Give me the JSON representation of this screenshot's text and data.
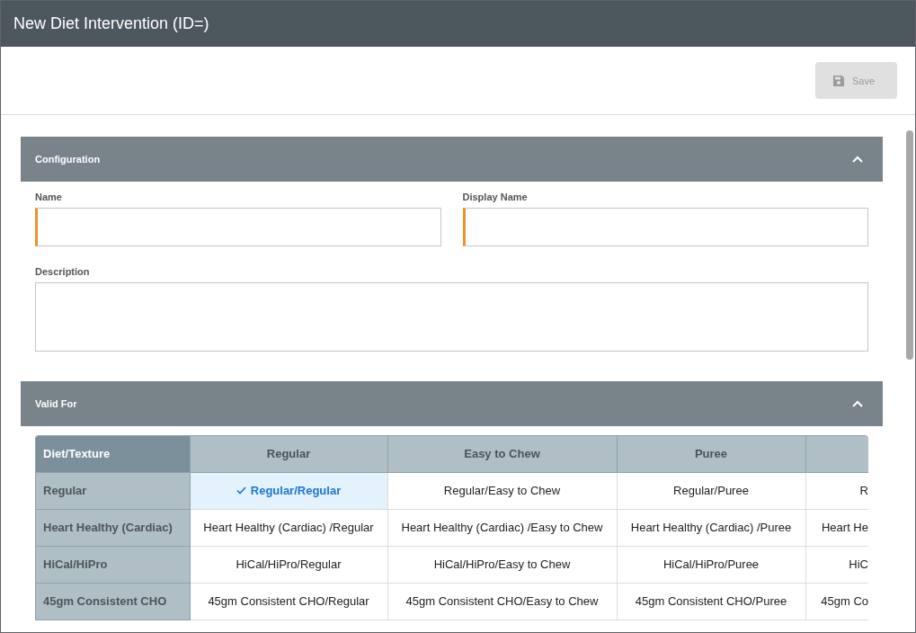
{
  "window": {
    "title": "New Diet Intervention (ID=)"
  },
  "toolbar": {
    "save_button": {
      "label": "Save",
      "disabled": true
    }
  },
  "sections": [
    {
      "title": "Configuration",
      "expanded": true,
      "fields": [
        {
          "label": "Name",
          "kind": "text",
          "required": true
        },
        {
          "label": "Display Name",
          "kind": "text",
          "required": true
        },
        {
          "label": "Description",
          "kind": "textarea",
          "required": false
        }
      ]
    },
    {
      "title": "Valid For",
      "expanded": true,
      "table": {
        "corner": "Diet/Texture",
        "columns": [
          "Regular",
          "Easy to Chew",
          "Puree"
        ],
        "rows": [
          {
            "label": "Regular",
            "cells": [
              {
                "text": "Regular/Regular",
                "selected": true
              },
              {
                "text": "Regular/Easy to Chew",
                "selected": false
              },
              {
                "text": "Regular/Puree",
                "selected": false
              },
              {
                "text": "R",
                "selected": false
              }
            ]
          },
          {
            "label": "Heart Healthy (Cardiac)",
            "cells": [
              {
                "text": "Heart Healthy (Cardiac) /Regular",
                "selected": false
              },
              {
                "text": "Heart Healthy (Cardiac) /Easy to Chew",
                "selected": false
              },
              {
                "text": "Heart Healthy (Cardiac) /Puree",
                "selected": false
              },
              {
                "text": "Heart He",
                "selected": false
              }
            ]
          },
          {
            "label": "HiCal/HiPro",
            "cells": [
              {
                "text": "HiCal/HiPro/Regular",
                "selected": false
              },
              {
                "text": "HiCal/HiPro/Easy to Chew",
                "selected": false
              },
              {
                "text": "HiCal/HiPro/Puree",
                "selected": false
              },
              {
                "text": "HiC",
                "selected": false
              }
            ]
          },
          {
            "label": "45gm Consistent CHO",
            "cells": [
              {
                "text": "45gm Consistent CHO/Regular",
                "selected": false
              },
              {
                "text": "45gm Consistent CHO/Easy to Chew",
                "selected": false
              },
              {
                "text": "45gm Consistent CHO/Puree",
                "selected": false
              },
              {
                "text": "45gm Co",
                "selected": false
              }
            ]
          }
        ]
      }
    }
  ]
}
